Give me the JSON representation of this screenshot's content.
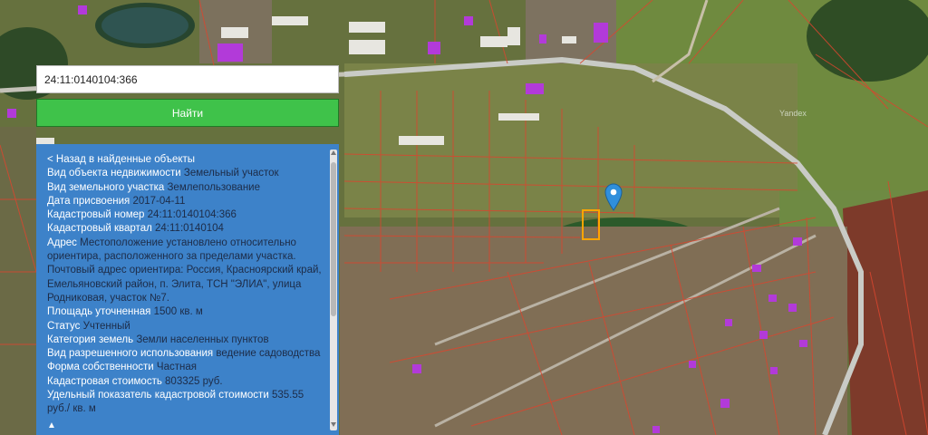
{
  "search": {
    "value": "24:11:0140104:366",
    "button_label": "Найти"
  },
  "info": {
    "back_link": "< Назад в найденные объекты",
    "rows": [
      {
        "label": "Вид объекта недвижимости",
        "value": "Земельный участок"
      },
      {
        "label": "Вид земельного участка",
        "value": "Землепользование"
      },
      {
        "label": "Дата присвоения",
        "value": "2017-04-11"
      },
      {
        "label": "Кадастровый номер",
        "value": "24:11:0140104:366"
      },
      {
        "label": "Кадастровый квартал",
        "value": "24:11:0140104"
      },
      {
        "label": "Адрес",
        "value": "Местоположение установлено относительно ориентира, расположенного за пределами участка. Почтовый адрес ориентира: Россия, Красноярский край, Емельяновский район, п. Элита, ТСН \"ЭЛИА\", улица Родниковая, участок №7."
      },
      {
        "label": "Площадь уточненная",
        "value": "1500 кв. м"
      },
      {
        "label": "Статус",
        "value": "Учтенный"
      },
      {
        "label": "Категория земель",
        "value": "Земли населенных пунктов"
      },
      {
        "label": "Вид разрешенного использования",
        "value": "ведение садоводства"
      },
      {
        "label": "Форма собственности",
        "value": "Частная"
      },
      {
        "label": "Кадастровая стоимость",
        "value": "803325 руб."
      },
      {
        "label": "Удельный показатель кадастровой стоимости",
        "value": "535.55 руб./ кв. м"
      }
    ],
    "collapse_glyph": "▲"
  },
  "map": {
    "watermark": "Yandex",
    "colors": {
      "parcel_line": "#d9462f",
      "selected_parcel": "#ffa500",
      "marker": "#2f8fdc",
      "road": "#c9cbc6",
      "roof": "#b23ad9"
    }
  }
}
